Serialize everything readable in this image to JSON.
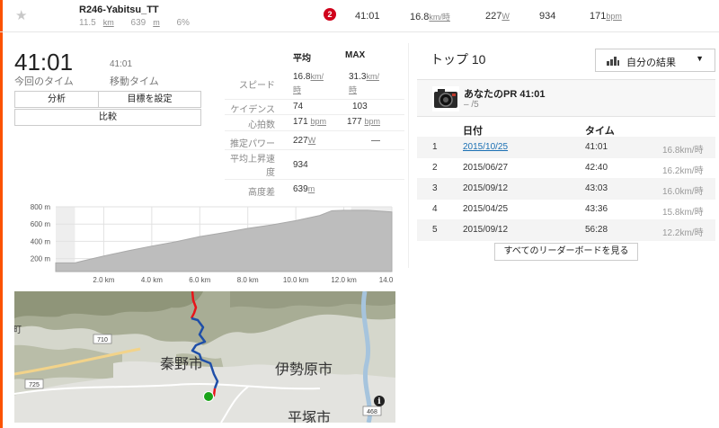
{
  "segment": {
    "name": "R246-Yabitsu_TT",
    "distance_value": "11.5",
    "distance_unit": "km",
    "elev_gain_value": "639",
    "elev_gain_unit": "m",
    "grade": "6%",
    "rank_badge": "2",
    "time": "41:01",
    "speed_value": "16.8",
    "speed_unit": "km/時",
    "power_value": "227",
    "power_unit": "W",
    "vam": "934",
    "hr_value": "171",
    "hr_unit": "bpm"
  },
  "effort": {
    "elapsed_time": "41:01",
    "elapsed_label": "今回のタイム",
    "moving_time": "41:01",
    "moving_label": "移動タイム",
    "analysis_button": "分析",
    "set_goal_button": "目標を設定",
    "compare_button": "比較"
  },
  "stats": {
    "col_avg": "平均",
    "col_max": "MAX",
    "speed_label": "スピード",
    "speed_avg": "16.8",
    "speed_max": "31.3",
    "speed_unit_a": "km/",
    "speed_unit_b": "時",
    "cadence_label": "ケイデンス",
    "cadence_avg": "74",
    "cadence_max": "103",
    "hr_label": "心拍数",
    "hr_avg": "171",
    "hr_max": "177",
    "hr_unit": "bpm",
    "power_label": "推定パワー",
    "power_avg": "227",
    "power_unit": "W",
    "power_max": "—",
    "vam_label_a": "平均上昇速",
    "vam_label_b": "度",
    "vam_value": "934",
    "elev_label": "高度差",
    "elev_value": "639",
    "elev_unit": "m"
  },
  "chart_data": {
    "type": "area",
    "x": [
      0,
      0.8,
      1.0,
      2,
      3,
      4,
      5,
      6,
      7,
      8,
      9,
      10,
      11,
      11.5,
      12,
      13,
      14
    ],
    "y": [
      150,
      150,
      165,
      230,
      290,
      345,
      395,
      455,
      500,
      550,
      590,
      640,
      700,
      755,
      760,
      760,
      740
    ],
    "xticks": [
      "2.0 km",
      "4.0 km",
      "6.0 km",
      "8.0 km",
      "10.0 km",
      "12.0 km",
      "14.0 km"
    ],
    "xtick_values": [
      2,
      4,
      6,
      8,
      10,
      12,
      14
    ],
    "yticks": [
      "200 m",
      "400 m",
      "600 m",
      "800 m"
    ],
    "ytick_values": [
      200,
      400,
      600,
      800
    ],
    "xlim": [
      0,
      14
    ],
    "ylim": [
      50,
      800
    ],
    "segment_range": [
      0.8,
      12.3
    ],
    "grid": true
  },
  "map": {
    "city1": "秦野市",
    "city2": "伊勢原市",
    "city3": "平塚市",
    "route1": "710",
    "route2": "725",
    "route3": "468",
    "edge_label": "町",
    "info_icon_label": "i"
  },
  "leaderboard": {
    "title": "トップ 10",
    "filter_label": "自分の結果",
    "pr_label": "あなたのPR 41:01",
    "pr_sub": "– /5",
    "col_date": "日付",
    "col_time": "タイム",
    "rows": [
      {
        "rank": "1",
        "date": "2015/10/25",
        "time": "41:01",
        "speed": "16.8km/時"
      },
      {
        "rank": "2",
        "date": "2015/06/27",
        "time": "42:40",
        "speed": "16.2km/時"
      },
      {
        "rank": "3",
        "date": "2015/09/12",
        "time": "43:03",
        "speed": "16.0km/時"
      },
      {
        "rank": "4",
        "date": "2015/04/25",
        "time": "43:36",
        "speed": "15.8km/時"
      },
      {
        "rank": "5",
        "date": "2015/09/12",
        "time": "56:28",
        "speed": "12.2km/時"
      }
    ],
    "view_all_button": "すべてのリーダーボードを見る"
  },
  "colors": {
    "accent": "#fc5200",
    "badge": "#d0021b",
    "link": "#1a6fb3",
    "route_red": "#e8141a",
    "route_blue": "#1f4fa8",
    "start_green": "#19a319",
    "chart_fill": "#bdbdbd"
  }
}
